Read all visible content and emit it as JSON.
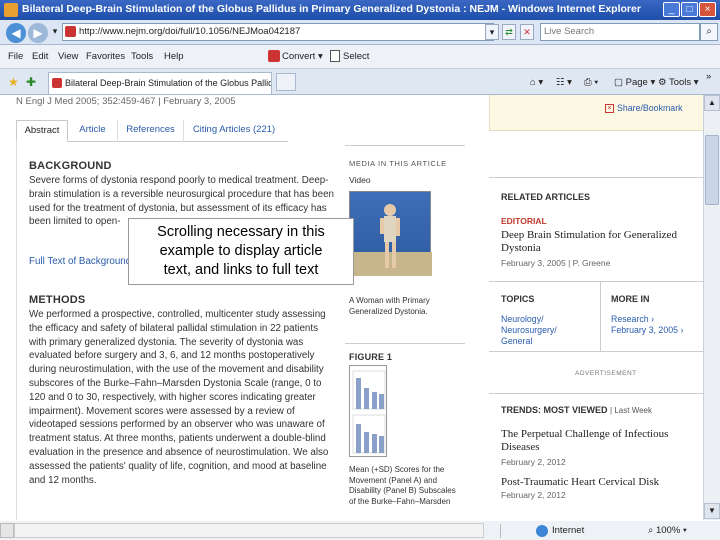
{
  "window": {
    "title": "Bilateral Deep-Brain Stimulation of the Globus Pallidus in Primary Generalized Dystonia : NEJM - Windows Internet Explorer",
    "min": "_",
    "max": "□",
    "close": "×"
  },
  "address": {
    "url": "http://www.nejm.org/doi/full/10.1056/NEJMoa042187",
    "search_placeholder": "Live Search"
  },
  "menu": {
    "items": [
      "File",
      "Edit",
      "View",
      "Favorites",
      "Tools",
      "Help"
    ],
    "convert": "Convert",
    "select": "Select"
  },
  "tab": {
    "title": "Bilateral Deep-Brain Stimulation of the Globus Pallidus ...",
    "page_label": "Page",
    "tools_label": "Tools",
    "chevron": "»"
  },
  "article": {
    "citation": "N Engl J Med 2005; 352:459-467",
    "date": "February 3, 2005",
    "tabs": [
      "Abstract",
      "Article",
      "References",
      "Citing Articles (221)"
    ],
    "background_heading": "BACKGROUND",
    "background_lines": [
      "Severe forms of dystonia respond poorly to medical treatment. Deep-",
      "brain stimulation is a reversible neurosurgical procedure that has been",
      "used for the treatment of dystonia, but assessment of its efficacy has",
      "been limited to open-"
    ],
    "full_text_link": "Full Text of Background...",
    "methods_heading": "METHODS",
    "methods_lines": [
      "We performed a prospective, controlled, multicenter study assessing",
      "the efficacy and safety of bilateral pallidal stimulation in 22 patients",
      "with primary generalized dystonia. The severity of dystonia was",
      "evaluated before surgery and 3, 6, and 12 months postoperatively",
      "during neurostimulation, with the use of the movement and disability",
      "subscores of the Burke–Fahn–Marsden Dystonia Scale (range, 0 to",
      "120 and 0 to 30, respectively, with higher scores indicating greater",
      "impairment). Movement scores were assessed by a review of",
      "videotaped sessions performed by an observer who was unaware of",
      "treatment status. At three months, patients underwent a double-blind",
      "evaluation in the presence and absence of neurostimulation. We also",
      "assessed the patients' quality of life, cognition, and mood at baseline",
      "and 12 months."
    ]
  },
  "media": {
    "heading": "MEDIA IN THIS ARTICLE",
    "video_label": "Video",
    "video_caption": "A Woman with Primary Generalized Dystonia.",
    "figure_heading": "FIGURE 1",
    "figure_caption_lines": [
      "Mean (+SD) Scores for the",
      "Movement (Panel A) and",
      "Disability (Panel B) Subscales",
      "of the Burke–Fahn–Marsden"
    ]
  },
  "right": {
    "top_links": [
      "Share/Bookmark"
    ],
    "related_heading": "RELATED ARTICLES",
    "editorial_label": "EDITORIAL",
    "editorial_title": "Deep Brain Stimulation for Generalized Dystonia",
    "editorial_date": "February 3, 2005",
    "editorial_author": "P. Greene",
    "topics_heading": "TOPICS",
    "topics_links": [
      "Neurology/",
      "Neurosurgery/",
      "General"
    ],
    "more_heading": "MORE IN",
    "more_links": [
      "Research ›",
      "February 3, 2005 ›"
    ],
    "advertisement": "ADVERTISEMENT",
    "trends_heading": "TRENDS: MOST VIEWED",
    "trends_period": "Last Week",
    "trend1_title": "The Perpetual Challenge of Infectious Diseases",
    "trend1_date": "February 2, 2012",
    "trend2_title": "Post-Traumatic Heart Cervical Disk",
    "trend2_date": "February 2, 2012"
  },
  "overlay": {
    "lines": [
      "Scrolling necessary in this",
      "example to display article",
      "text, and links to full text"
    ]
  },
  "status": {
    "zone": "Internet",
    "zoom": "100%"
  },
  "colors": {
    "title_bar": "#1d4ea8",
    "link": "#2a5cab",
    "editorial": "#c0392b",
    "sidebar_bg": "#fdf8e4"
  }
}
